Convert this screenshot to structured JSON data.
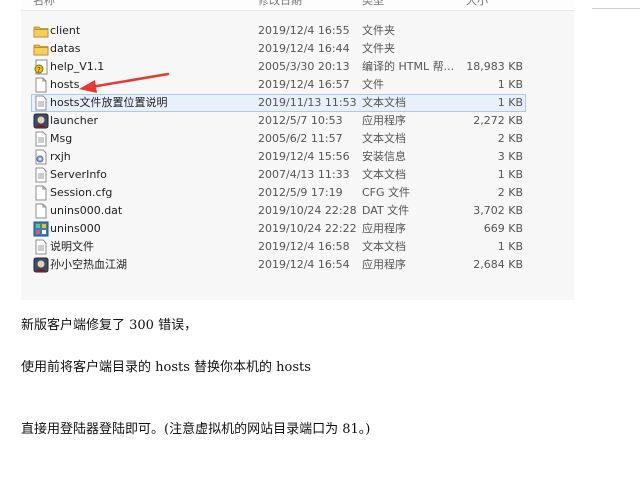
{
  "header": {
    "col_name": "名称",
    "col_date": "修改日期",
    "col_type": "类型",
    "col_size": "大小"
  },
  "files": [
    {
      "name": "client",
      "date": "2019/12/4 16:55",
      "type": "文件夹",
      "size": "",
      "icon": "folder-icon"
    },
    {
      "name": "datas",
      "date": "2019/12/4 16:44",
      "type": "文件夹",
      "size": "",
      "icon": "folder-icon"
    },
    {
      "name": "help_V1.1",
      "date": "2005/3/30 20:13",
      "type": "编译的 HTML 帮...",
      "size": "18,983 KB",
      "icon": "help-file-icon"
    },
    {
      "name": "hosts",
      "date": "2019/12/4 16:57",
      "type": "文件",
      "size": "1 KB",
      "icon": "blank-file-icon"
    },
    {
      "name": "hosts文件放置位置说明",
      "date": "2019/11/13 11:53",
      "type": "文本文档",
      "size": "1 KB",
      "icon": "text-file-icon"
    },
    {
      "name": "launcher",
      "date": "2012/5/7 10:53",
      "type": "应用程序",
      "size": "2,272 KB",
      "icon": "app-icon"
    },
    {
      "name": "Msg",
      "date": "2005/6/2 11:57",
      "type": "文本文档",
      "size": "2 KB",
      "icon": "text-file-icon"
    },
    {
      "name": "rxjh",
      "date": "2019/12/4 15:56",
      "type": "安装信息",
      "size": "3 KB",
      "icon": "settings-file-icon"
    },
    {
      "name": "ServerInfo",
      "date": "2007/4/13 11:33",
      "type": "文本文档",
      "size": "1 KB",
      "icon": "text-file-icon"
    },
    {
      "name": "Session.cfg",
      "date": "2012/5/9 17:19",
      "type": "CFG 文件",
      "size": "2 KB",
      "icon": "blank-file-icon"
    },
    {
      "name": "unins000.dat",
      "date": "2019/10/24 22:28",
      "type": "DAT 文件",
      "size": "3,702 KB",
      "icon": "blank-file-icon"
    },
    {
      "name": "unins000",
      "date": "2019/10/24 22:22",
      "type": "应用程序",
      "size": "669 KB",
      "icon": "installer-icon"
    },
    {
      "name": "说明文件",
      "date": "2019/12/4 16:58",
      "type": "文本文档",
      "size": "1 KB",
      "icon": "text-file-icon"
    },
    {
      "name": "孙小空热血江湖",
      "date": "2019/12/4 16:54",
      "type": "应用程序",
      "size": "2,684 KB",
      "icon": "app-icon"
    }
  ],
  "article": {
    "line1": "新版客户端修复了 300 错误，",
    "line2": "使用前将客户端目录的 hosts 替换你本机的 hosts",
    "line3": "直接用登陆器登陆即可。(注意虚拟机的网站目录端口为 81。)"
  },
  "colors": {
    "folder": "#e8b93a",
    "selection": "#e8f1fb",
    "arrow": "#e53935"
  }
}
